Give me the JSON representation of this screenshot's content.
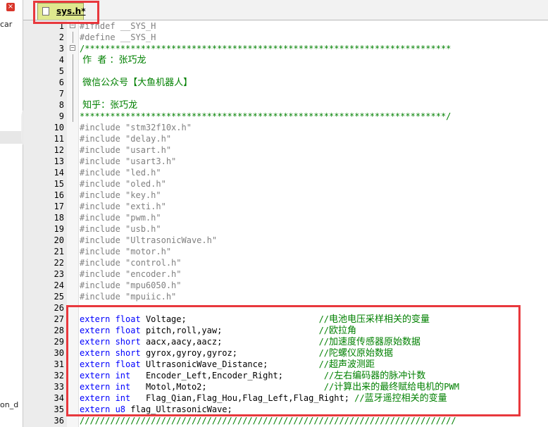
{
  "left_pane": {
    "close_glyph": "×",
    "top_label": "car",
    "bottom_label": "on_d"
  },
  "tab": {
    "label": "sys.h*"
  },
  "lines": [
    {
      "n": "1",
      "fold": "−",
      "segs": [
        {
          "c": "c-pre",
          "t": "#ifndef __SYS_H"
        }
      ]
    },
    {
      "n": "2",
      "segs": [
        {
          "c": "c-pre",
          "t": "#define __SYS_H"
        }
      ]
    },
    {
      "n": "3",
      "fold": "−",
      "segs": [
        {
          "c": "c-cmt",
          "t": "/************************************************************************"
        }
      ]
    },
    {
      "n": "4",
      "segs": [
        {
          "c": "c-cn",
          "t": " 作  者 ：张巧龙"
        }
      ]
    },
    {
      "n": "5",
      "segs": []
    },
    {
      "n": "6",
      "segs": [
        {
          "c": "c-cn",
          "t": " 微信公众号【大鱼机器人】"
        }
      ]
    },
    {
      "n": "7",
      "segs": []
    },
    {
      "n": "8",
      "segs": [
        {
          "c": "c-cn",
          "t": " 知乎：张巧龙"
        }
      ]
    },
    {
      "n": "9",
      "segs": [
        {
          "c": "c-cmt",
          "t": "************************************************************************/"
        }
      ]
    },
    {
      "n": "10",
      "segs": [
        {
          "c": "c-pre",
          "t": "#include "
        },
        {
          "c": "c-str",
          "t": "\"stm32f10x.h\""
        }
      ]
    },
    {
      "n": "11",
      "segs": [
        {
          "c": "c-pre",
          "t": "#include "
        },
        {
          "c": "c-str",
          "t": "\"delay.h\""
        }
      ]
    },
    {
      "n": "12",
      "segs": [
        {
          "c": "c-pre",
          "t": "#include "
        },
        {
          "c": "c-str",
          "t": "\"usart.h\""
        }
      ]
    },
    {
      "n": "13",
      "segs": [
        {
          "c": "c-pre",
          "t": "#include "
        },
        {
          "c": "c-str",
          "t": "\"usart3.h\""
        }
      ]
    },
    {
      "n": "14",
      "segs": [
        {
          "c": "c-pre",
          "t": "#include "
        },
        {
          "c": "c-str",
          "t": "\"led.h\""
        }
      ]
    },
    {
      "n": "15",
      "segs": [
        {
          "c": "c-pre",
          "t": "#include "
        },
        {
          "c": "c-str",
          "t": "\"oled.h\""
        }
      ]
    },
    {
      "n": "16",
      "segs": [
        {
          "c": "c-pre",
          "t": "#include "
        },
        {
          "c": "c-str",
          "t": "\"key.h\""
        }
      ]
    },
    {
      "n": "17",
      "segs": [
        {
          "c": "c-pre",
          "t": "#include "
        },
        {
          "c": "c-str",
          "t": "\"exti.h\""
        }
      ]
    },
    {
      "n": "18",
      "segs": [
        {
          "c": "c-pre",
          "t": "#include "
        },
        {
          "c": "c-str",
          "t": "\"pwm.h\""
        }
      ]
    },
    {
      "n": "19",
      "segs": [
        {
          "c": "c-pre",
          "t": "#include "
        },
        {
          "c": "c-str",
          "t": "\"usb.h\""
        }
      ]
    },
    {
      "n": "20",
      "segs": [
        {
          "c": "c-pre",
          "t": "#include "
        },
        {
          "c": "c-str",
          "t": "\"UltrasonicWave.h\""
        }
      ]
    },
    {
      "n": "21",
      "segs": [
        {
          "c": "c-pre",
          "t": "#include "
        },
        {
          "c": "c-str",
          "t": "\"motor.h\""
        }
      ]
    },
    {
      "n": "22",
      "segs": [
        {
          "c": "c-pre",
          "t": "#include "
        },
        {
          "c": "c-str",
          "t": "\"control.h\""
        }
      ]
    },
    {
      "n": "23",
      "segs": [
        {
          "c": "c-pre",
          "t": "#include "
        },
        {
          "c": "c-str",
          "t": "\"encoder.h\""
        }
      ]
    },
    {
      "n": "24",
      "segs": [
        {
          "c": "c-pre",
          "t": "#include "
        },
        {
          "c": "c-str",
          "t": "\"mpu6050.h\""
        }
      ]
    },
    {
      "n": "25",
      "segs": [
        {
          "c": "c-pre",
          "t": "#include "
        },
        {
          "c": "c-str",
          "t": "\"mpuiic.h\""
        }
      ]
    },
    {
      "n": "26",
      "segs": []
    },
    {
      "n": "27",
      "segs": [
        {
          "c": "c-kw",
          "t": "extern "
        },
        {
          "c": "c-type",
          "t": "float "
        },
        {
          "c": "c-ident",
          "t": "Voltage;                          "
        },
        {
          "c": "c-cmt",
          "t": "//"
        },
        {
          "c": "c-cn",
          "t": "电池电压采样相关的变量"
        }
      ]
    },
    {
      "n": "28",
      "segs": [
        {
          "c": "c-kw",
          "t": "extern "
        },
        {
          "c": "c-type",
          "t": "float "
        },
        {
          "c": "c-ident",
          "t": "pitch,roll,yaw;                   "
        },
        {
          "c": "c-cmt",
          "t": "//"
        },
        {
          "c": "c-cn",
          "t": "欧拉角"
        }
      ]
    },
    {
      "n": "29",
      "segs": [
        {
          "c": "c-kw",
          "t": "extern "
        },
        {
          "c": "c-type",
          "t": "short "
        },
        {
          "c": "c-ident",
          "t": "aacx,aacy,aacz;                   "
        },
        {
          "c": "c-cmt",
          "t": "//"
        },
        {
          "c": "c-cn",
          "t": "加速度传感器原始数据"
        }
      ]
    },
    {
      "n": "30",
      "segs": [
        {
          "c": "c-kw",
          "t": "extern "
        },
        {
          "c": "c-type",
          "t": "short "
        },
        {
          "c": "c-ident",
          "t": "gyrox,gyroy,gyroz;                "
        },
        {
          "c": "c-cmt",
          "t": "//"
        },
        {
          "c": "c-cn",
          "t": "陀螺仪原始数据"
        }
      ]
    },
    {
      "n": "31",
      "segs": [
        {
          "c": "c-kw",
          "t": "extern "
        },
        {
          "c": "c-type",
          "t": "float "
        },
        {
          "c": "c-ident",
          "t": "UltrasonicWave_Distance;          "
        },
        {
          "c": "c-cmt",
          "t": "//"
        },
        {
          "c": "c-cn",
          "t": "超声波测距"
        }
      ]
    },
    {
      "n": "32",
      "segs": [
        {
          "c": "c-kw",
          "t": "extern "
        },
        {
          "c": "c-type",
          "t": "int   "
        },
        {
          "c": "c-ident",
          "t": "Encoder_Left,Encoder_Right;        "
        },
        {
          "c": "c-cmt",
          "t": "//"
        },
        {
          "c": "c-cn",
          "t": "左右编码器的脉冲计数"
        }
      ]
    },
    {
      "n": "33",
      "segs": [
        {
          "c": "c-kw",
          "t": "extern "
        },
        {
          "c": "c-type",
          "t": "int   "
        },
        {
          "c": "c-ident",
          "t": "Motol,Moto2;                       "
        },
        {
          "c": "c-cmt",
          "t": "//"
        },
        {
          "c": "c-cn",
          "t": "计算出来的最终赋给电机的"
        },
        {
          "c": "c-cmt",
          "t": "PWM"
        }
      ]
    },
    {
      "n": "34",
      "segs": [
        {
          "c": "c-kw",
          "t": "extern "
        },
        {
          "c": "c-type",
          "t": "int   "
        },
        {
          "c": "c-ident",
          "t": "Flag_Qian,Flag_Hou,Flag_Left,Flag_Right; "
        },
        {
          "c": "c-cmt",
          "t": "//"
        },
        {
          "c": "c-cn",
          "t": "蓝牙遥控相关的变量"
        }
      ]
    },
    {
      "n": "35",
      "segs": [
        {
          "c": "c-kw",
          "t": "extern "
        },
        {
          "c": "c-type",
          "t": "u8 "
        },
        {
          "c": "c-ident",
          "t": "flag_UltrasonicWave;"
        }
      ]
    },
    {
      "n": "36",
      "segs": [
        {
          "c": "c-cmt",
          "t": "//////////////////////////////////////////////////////////////////////////"
        }
      ]
    }
  ]
}
